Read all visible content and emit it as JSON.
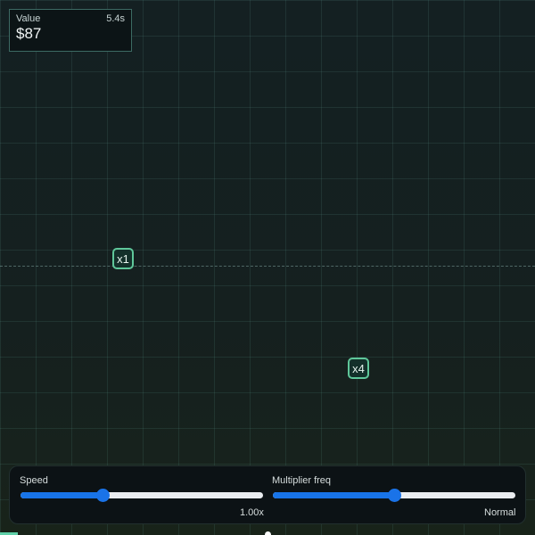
{
  "hud": {
    "value_label": "Value",
    "value_amount": "$87",
    "elapsed": "5.4s"
  },
  "multipliers": [
    {
      "label": "x1"
    },
    {
      "label": "x4"
    }
  ],
  "controls": {
    "speed": {
      "label": "Speed",
      "value_text": "1.00x",
      "fraction": 0.34
    },
    "multiplier_freq": {
      "label": "Multiplier freq",
      "value_text": "Normal",
      "fraction": 0.5
    }
  },
  "progress": {
    "fraction": 0.0
  },
  "colors": {
    "accent_green": "#5fc79a",
    "slider_blue": "#1a73e8",
    "panel_border": "#3c6a63"
  }
}
